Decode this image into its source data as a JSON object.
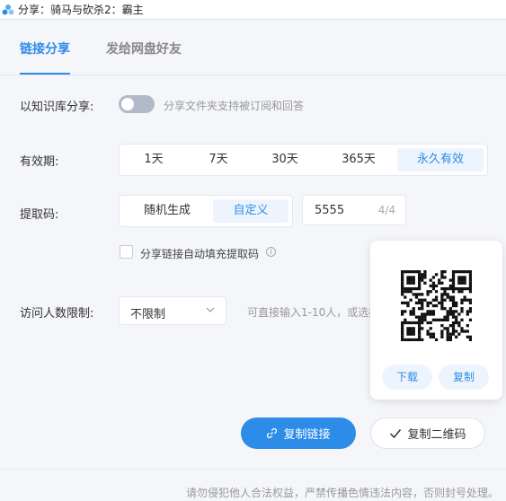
{
  "window": {
    "title": "分享：骑马与砍杀2：霸主",
    "icon": "cloud-share-icon"
  },
  "tabs": [
    {
      "label": "链接分享",
      "active": true
    },
    {
      "label": "发给网盘好友",
      "active": false
    }
  ],
  "knowledge": {
    "label": "以知识库分享:",
    "enabled": false,
    "hint": "分享文件夹支持被订阅和回答"
  },
  "validity": {
    "label": "有效期:",
    "options": [
      "1天",
      "7天",
      "30天",
      "365天",
      "永久有效"
    ],
    "selected": "永久有效"
  },
  "extract_code": {
    "label": "提取码:",
    "options": [
      "随机生成",
      "自定义"
    ],
    "selected": "自定义",
    "value": "5555",
    "counter": "4/4",
    "autofill_label": "分享链接自动填充提取码",
    "autofill_checked": false
  },
  "visitor_limit": {
    "label": "访问人数限制:",
    "value": "不限制",
    "hint": "可直接输入1-10人，或选择"
  },
  "qr_popup": {
    "download_label": "下载",
    "copy_label": "复制"
  },
  "actions": {
    "copy_link_label": "复制链接",
    "copy_qr_label": "复制二维码"
  },
  "footer": {
    "notice": "请勿侵犯他人合法权益，严禁传播色情违法内容，否则封号处理。"
  },
  "colors": {
    "accent": "#2e8ce9",
    "accent_light": "#eef4fd",
    "background": "#f5f6fa"
  }
}
